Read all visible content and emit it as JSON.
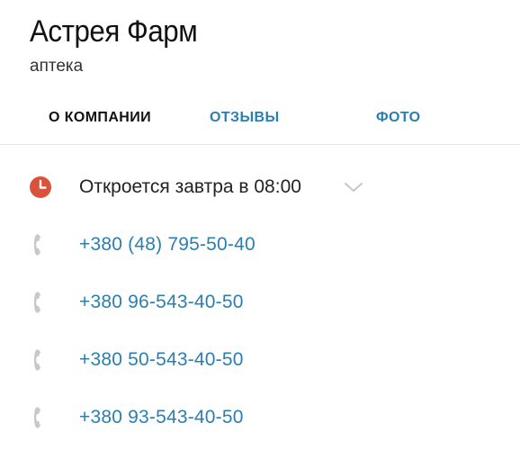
{
  "place": {
    "name": "Астрея Фарм",
    "category": "аптека"
  },
  "tabs": [
    {
      "label": "О КОМПАНИИ",
      "active": true
    },
    {
      "label": "ОТЗЫВЫ",
      "active": false
    },
    {
      "label": "ФОТО",
      "active": false
    }
  ],
  "hours": {
    "status": "Откроется завтра в 08:00",
    "icon": "clock-icon",
    "icon_color": "#d9533c"
  },
  "phones": [
    "+380 (48) 795-50-40",
    "+380 96-543-40-50",
    "+380 50-543-40-50",
    "+380 93-543-40-50"
  ],
  "colors": {
    "link": "#2a7fb0",
    "text": "#111111",
    "icon_gray": "#c8c8c8"
  }
}
